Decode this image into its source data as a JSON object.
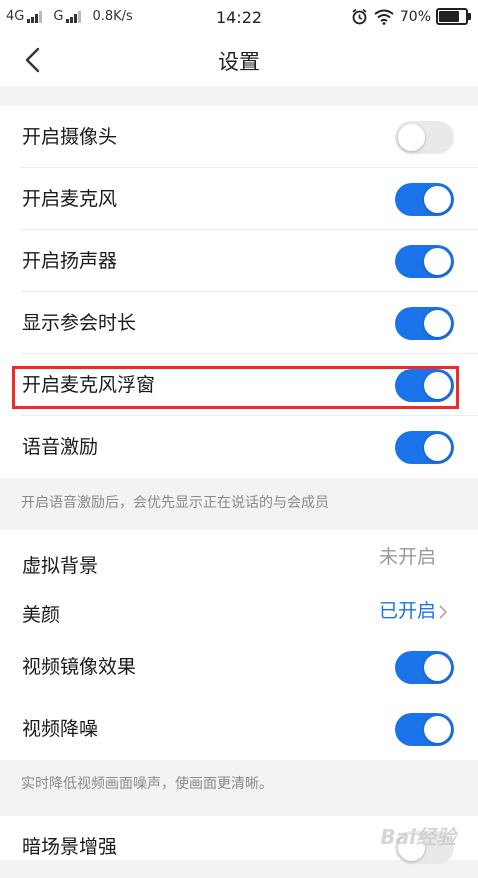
{
  "status_bar": {
    "net1": "4G",
    "net2": "G",
    "speed": "0.8K/s",
    "time": "14:22",
    "battery": "70%",
    "battery_level": 0.7
  },
  "header": {
    "title": "设置"
  },
  "settings": {
    "camera": {
      "label": "开启摄像头",
      "on": false
    },
    "mic": {
      "label": "开启麦克风",
      "on": true
    },
    "speaker": {
      "label": "开启扬声器",
      "on": true
    },
    "duration": {
      "label": "显示参会时长",
      "on": true
    },
    "mic_float": {
      "label": "开启麦克风浮窗",
      "on": true
    },
    "voice_incentive": {
      "label": "语音激励",
      "on": true
    },
    "voice_hint": "开启语音激励后，会优先显示正在说话的与会成员",
    "virtual_bg": {
      "label": "虚拟背景",
      "value": "未开启"
    },
    "beauty": {
      "label": "美颜",
      "value": "已开启"
    },
    "mirror": {
      "label": "视频镜像效果",
      "on": true
    },
    "denoise": {
      "label": "视频降噪",
      "on": true
    },
    "denoise_hint": "实时降低视频画面噪声，使画面更清晰。",
    "dark_enhance": {
      "label": "暗场景增强"
    }
  },
  "colors": {
    "accent": "#1a73e8",
    "highlight": "#ee2a2a"
  },
  "watermark": "Bai经验"
}
